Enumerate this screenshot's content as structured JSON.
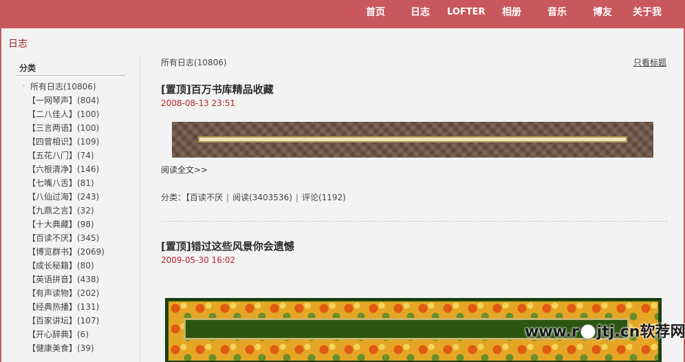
{
  "nav": {
    "items": [
      {
        "label": "首页"
      },
      {
        "label": "日志"
      },
      {
        "label": "LOFTER"
      },
      {
        "label": "相册"
      },
      {
        "label": "音乐"
      },
      {
        "label": "博友"
      },
      {
        "label": "关于我"
      }
    ]
  },
  "page": {
    "title": "日志"
  },
  "sidebar": {
    "heading": "分类",
    "categories": [
      "所有日志(10806)",
      "【一网琴声】(804)",
      "【二八佳人】(100)",
      "【三言两语】(100)",
      "【四曾相识】(109)",
      "【五花八门】(74)",
      "【六根清净】(146)",
      "【七嘴八舌】(81)",
      "【八仙过海】(243)",
      "【九鼎之言】(32)",
      "【十大典藏】(98)",
      "【百读不厌】(345)",
      "【博览群书】(2069)",
      "【成长秘籍】(80)",
      "【英语拼音】(438)",
      "【有声读物】(202)",
      "【经典热播】(131)",
      "【百家讲坛】(107)",
      "【开心辞典】(6)",
      "【健康美食】(39)"
    ]
  },
  "main": {
    "all_count": "所有日志(10806)",
    "titles_only": "只看标题",
    "posts": [
      {
        "title": "[置顶]百万书库精品收藏",
        "date": "2008-08-13 23:51",
        "read_more": "阅读全文>>",
        "category_label": "分类：",
        "category": "【百读不厌",
        "reads": "阅读(3403536)",
        "comments": "评论(1192)"
      },
      {
        "title": "[置顶]错过这些风景你会遗憾",
        "date": "2009-05-30 16:02"
      }
    ]
  },
  "watermark": {
    "left": "www.r",
    "mid": "jtj.cn",
    "right": "软荐网"
  }
}
